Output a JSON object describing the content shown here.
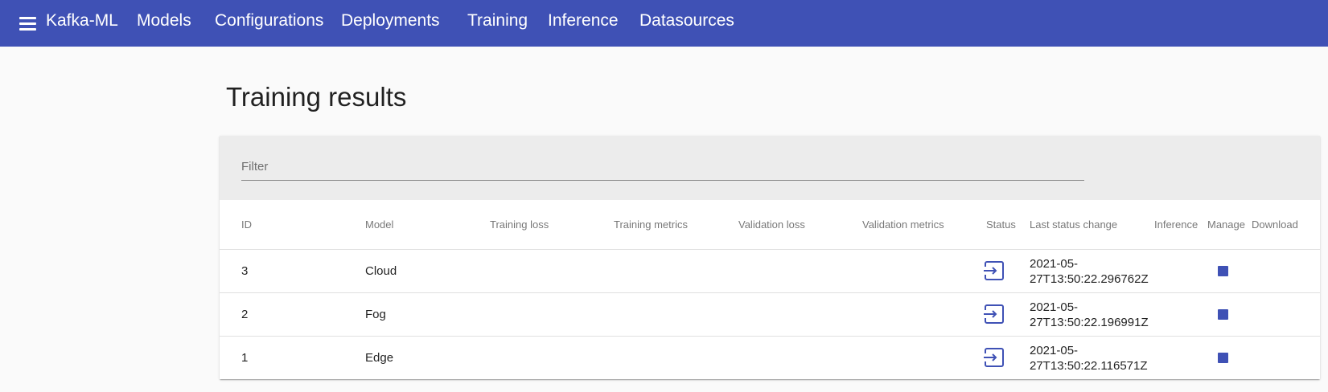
{
  "app": {
    "brand": "Kafka-ML",
    "nav": [
      "Models",
      "Configurations",
      "Deployments",
      "Training",
      "Inference",
      "Datasources"
    ]
  },
  "page": {
    "title": "Training results"
  },
  "filter": {
    "placeholder": "Filter",
    "value": ""
  },
  "table": {
    "columns": [
      "ID",
      "Model",
      "Training loss",
      "Training metrics",
      "Validation loss",
      "Validation metrics",
      "Status",
      "Last status change",
      "Inference",
      "Manage",
      "Download"
    ],
    "rows": [
      {
        "id": "3",
        "model": "Cloud",
        "training_loss": "",
        "training_metrics": "",
        "validation_loss": "",
        "validation_metrics": "",
        "status_icon": "input-icon",
        "last_change_line1": "2021-05-",
        "last_change_line2": "27T13:50:22.296762Z",
        "manage_icon": "stop-icon"
      },
      {
        "id": "2",
        "model": "Fog",
        "training_loss": "",
        "training_metrics": "",
        "validation_loss": "",
        "validation_metrics": "",
        "status_icon": "input-icon",
        "last_change_line1": "2021-05-",
        "last_change_line2": "27T13:50:22.196991Z",
        "manage_icon": "stop-icon"
      },
      {
        "id": "1",
        "model": "Edge",
        "training_loss": "",
        "training_metrics": "",
        "validation_loss": "",
        "validation_metrics": "",
        "status_icon": "input-icon",
        "last_change_line1": "2021-05-",
        "last_change_line2": "27T13:50:22.116571Z",
        "manage_icon": "stop-icon"
      }
    ]
  },
  "colors": {
    "primary": "#3f51b5",
    "background": "#fafafa",
    "filter_bg": "#ececec"
  }
}
